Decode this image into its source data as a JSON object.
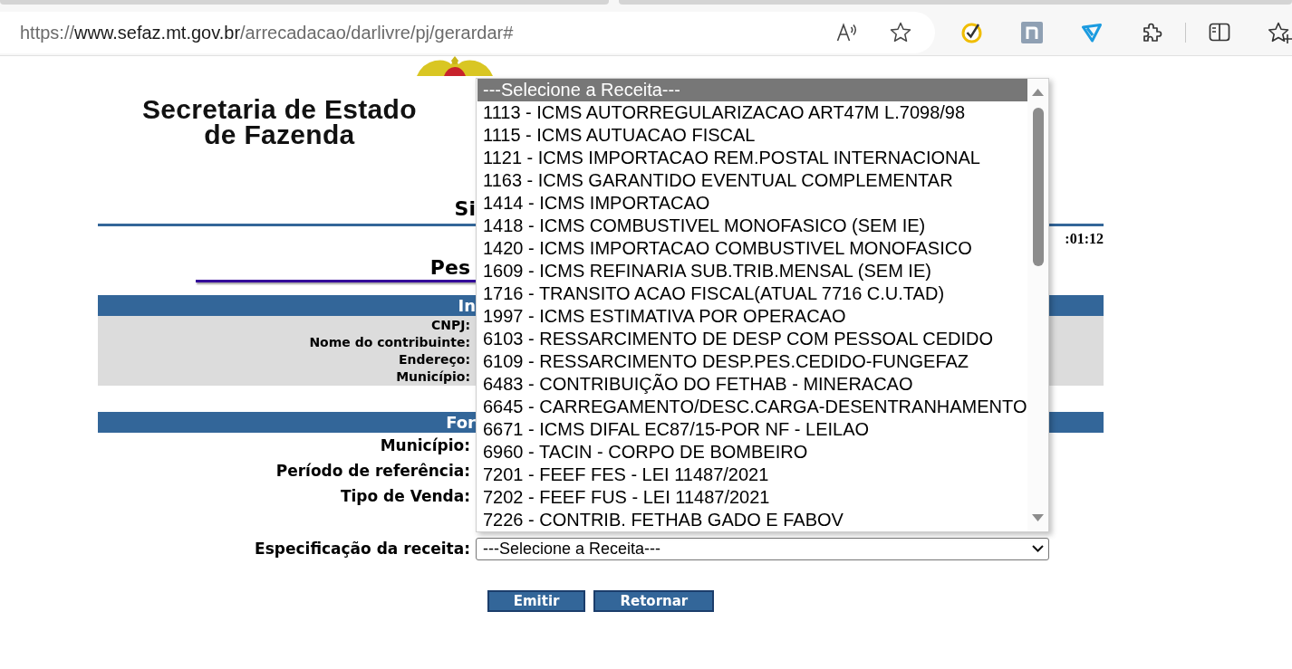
{
  "address_bar": {
    "scheme": "https://",
    "host": "www.sefaz.mt.gov.br",
    "path": "/arrecadacao/darlivre/pj/gerardar#"
  },
  "header": {
    "logo_lines": [
      "Secretaria de Estado",
      "de Fazenda"
    ],
    "title": "Si",
    "time": ":01:12",
    "subtitle": "Pes"
  },
  "info_section": {
    "title": "In",
    "labels": [
      "CNPJ:",
      "Nome do contribuinte:",
      "Endereço:",
      "Município:"
    ]
  },
  "form_section": {
    "title": "For",
    "labels": [
      "Município:",
      "Período de referência:",
      "Tipo de Venda:"
    ],
    "receita": {
      "label": "Especificação da receita:",
      "value": "---Selecione a Receita---"
    }
  },
  "buttons": [
    "Emitir",
    "Retornar"
  ],
  "dropdown": {
    "options": [
      {
        "text": "---Selecione a Receita---",
        "selected": true
      },
      {
        "text": "1113 - ICMS AUTORREGULARIZACAO ART47M L.7098/98",
        "selected": false
      },
      {
        "text": "1115 - ICMS AUTUACAO FISCAL",
        "selected": false
      },
      {
        "text": "1121 - ICMS IMPORTACAO REM.POSTAL INTERNACIONAL",
        "selected": false
      },
      {
        "text": "1163 - ICMS GARANTIDO EVENTUAL COMPLEMENTAR",
        "selected": false
      },
      {
        "text": "1414 - ICMS IMPORTACAO",
        "selected": false
      },
      {
        "text": "1418 - ICMS COMBUSTIVEL MONOFASICO (SEM IE)",
        "selected": false
      },
      {
        "text": "1420 - ICMS IMPORTACAO COMBUSTIVEL MONOFASICO",
        "selected": false
      },
      {
        "text": "1609 - ICMS REFINARIA SUB.TRIB.MENSAL (SEM IE)",
        "selected": false
      },
      {
        "text": "1716 - TRANSITO ACAO FISCAL(ATUAL 7716 C.U.TAD)",
        "selected": false
      },
      {
        "text": "1997 - ICMS ESTIMATIVA POR OPERACAO",
        "selected": false
      },
      {
        "text": "6103 - RESSARCIMENTO DE DESP COM PESSOAL CEDIDO",
        "selected": false
      },
      {
        "text": "6109 - RESSARCIMENTO DESP.PES.CEDIDO-FUNGEFAZ",
        "selected": false
      },
      {
        "text": "6483 - CONTRIBUIÇÃO DO FETHAB - MINERACAO",
        "selected": false
      },
      {
        "text": "6645 - CARREGAMENTO/DESC.CARGA-DESENTRANHAMENTO",
        "selected": false
      },
      {
        "text": "6671 - ICMS DIFAL EC87/15-POR NF - LEILAO",
        "selected": false
      },
      {
        "text": "6960 - TACIN - CORPO DE BOMBEIRO",
        "selected": false
      },
      {
        "text": "7201 - FEEF FES - LEI 11487/2021",
        "selected": false
      },
      {
        "text": "7202 - FEEF FUS - LEI 11487/2021",
        "selected": false
      },
      {
        "text": "7226 - CONTRIB. FETHAB GADO E FABOV",
        "selected": false
      }
    ]
  }
}
